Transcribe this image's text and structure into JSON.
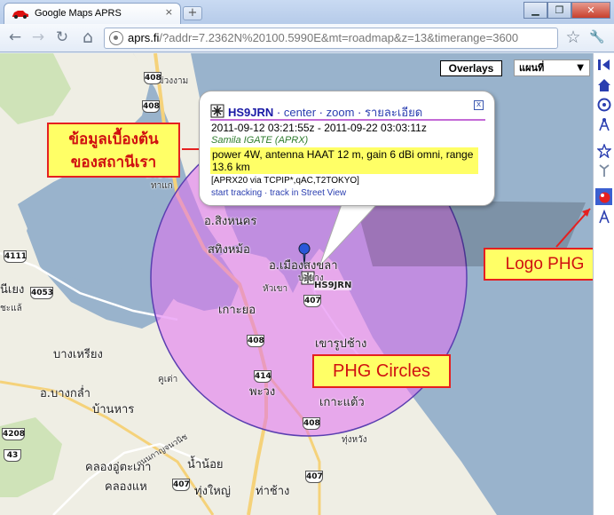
{
  "browser": {
    "tab_title": "Google Maps APRS",
    "tab_close": "×",
    "new_tab": "+",
    "window_buttons": [
      "▁",
      "❐",
      "✕"
    ],
    "url_host": "aprs.fi",
    "url_rest": "/?addr=7.2362N%20100.5990E&mt=roadmap&z=13&timerange=3600",
    "nav": {
      "back": "←",
      "forward": "→",
      "reload": "↻",
      "home": "⌂",
      "star": "☆",
      "wrench": "🔧"
    }
  },
  "map": {
    "overlays_label": "Overlays",
    "map_type": "แผนที่",
    "map_type_arrow": "▼",
    "phg_color": "#e8a0f0",
    "labels": [
      {
        "id": "muang-rong",
        "text": "ม่วงงาม"
      },
      {
        "id": "singhanakhon",
        "text": "อ.สิงหนคร"
      },
      {
        "id": "sathing-mo",
        "text": "สทิงหม้อ"
      },
      {
        "id": "mueang-songkhla",
        "text": "อ.เมืองสงขลา"
      },
      {
        "id": "bo-yang",
        "text": "บ่อยาง"
      },
      {
        "id": "hua-khao",
        "text": "หัวเขา"
      },
      {
        "id": "ko-yo",
        "text": "เกาะยอ"
      },
      {
        "id": "khao-rup-chang",
        "text": "เขารูปช้าง"
      },
      {
        "id": "thakham",
        "text": "ท่าข้าม"
      },
      {
        "id": "khu-tao",
        "text": "คูเต่า"
      },
      {
        "id": "ban-phru",
        "text": "บางเหรียง"
      },
      {
        "id": "ban-han",
        "text": "บ้านหาร"
      },
      {
        "id": "bang-klam",
        "text": "อ.บางกล่ำ"
      },
      {
        "id": "khlong-u-taphao",
        "text": "คลองอู่ตะเภา"
      },
      {
        "id": "khlong-hae",
        "text": "คลองแห"
      },
      {
        "id": "thung-yai",
        "text": "ทุ่งใหญ่"
      },
      {
        "id": "tha-chang",
        "text": "ท่าช้าง"
      },
      {
        "id": "nam-noi",
        "text": "น้ำน้อย"
      },
      {
        "id": "phawong",
        "text": "พะวง"
      },
      {
        "id": "ko-taeo",
        "text": "เกาะแต้ว"
      },
      {
        "id": "thung-wang",
        "text": "ทุ่งหวัง"
      },
      {
        "id": "nong-hoi",
        "text": "นีเยง"
      },
      {
        "id": "tha-kham",
        "text": "ทาแก"
      },
      {
        "id": "cha-ngae",
        "text": "ชะแล้"
      },
      {
        "id": "kanchanawanit",
        "text": "ถนนกาญจนวนิช"
      }
    ],
    "shields": [
      {
        "id": "408a",
        "text": "408"
      },
      {
        "id": "408b",
        "text": "408"
      },
      {
        "id": "408c",
        "text": "408"
      },
      {
        "id": "4111",
        "text": "4111"
      },
      {
        "id": "4053",
        "text": "4053"
      },
      {
        "id": "407a",
        "text": "407"
      },
      {
        "id": "414",
        "text": "414"
      },
      {
        "id": "408d",
        "text": "408"
      },
      {
        "id": "407b",
        "text": "407"
      },
      {
        "id": "4208",
        "text": "4208"
      },
      {
        "id": "43",
        "text": "43"
      },
      {
        "id": "407c",
        "text": "407"
      }
    ],
    "station_label": "HS9JRN"
  },
  "infowindow": {
    "callsign": "HS9JRN",
    "sep": "·",
    "link_center": "center",
    "link_zoom": "zoom",
    "link_details": "รายละเอียด",
    "close": "x",
    "time_range": "2011-09-12 03:21:55z - 2011-09-22 03:03:11z",
    "igate": "Samila IGATE (APRX)",
    "comment": "power 4W, antenna HAAT 12 m, gain 6 dBi omni, range 13.6 km",
    "path": "[APRX20 via TCPIP*,qAC,T2TOKYO]",
    "link_tracking": "start tracking",
    "link_streetview": "track in Street View"
  },
  "annotations": {
    "thai_line1": "ข้อมูลเบื้องต้น",
    "thai_line2": "ของสถานีเรา",
    "phg": "PHG Circles",
    "logo": "Logo PHG",
    "color": "#e52020"
  }
}
